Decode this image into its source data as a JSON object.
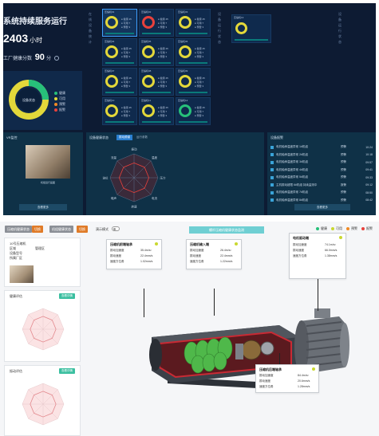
{
  "dashboard": {
    "title": "系统持续服务运行",
    "hours_value": "2403",
    "hours_unit": "小时",
    "health_label": "工厂健康分数",
    "health_score": "90",
    "health_unit": "分",
    "donut_center_label": "设备状态",
    "legend": [
      {
        "label": "健康",
        "color": "#27c07a"
      },
      {
        "label": "可用",
        "color": "#e3d83a"
      },
      {
        "label": "预警",
        "color": "#f08a24"
      },
      {
        "label": "报警",
        "color": "#e8413c"
      }
    ],
    "side_labels_left": [
      "在",
      "线",
      "设",
      "备",
      "统",
      "计"
    ],
    "side_labels_right": [
      "设",
      "备",
      "运",
      "行",
      "状",
      "态"
    ],
    "gauges": [
      {
        "name": "压缩机01",
        "ring": "#e3d83a",
        "selected": true
      },
      {
        "name": "压缩机02",
        "ring": "#e8413c",
        "selected": false
      },
      {
        "name": "压缩机03",
        "ring": "#e3d83a",
        "selected": false
      },
      {
        "name": "压缩机04",
        "ring": "#e3d83a",
        "selected": false
      },
      {
        "name": "压缩机05",
        "ring": "#e3d83a",
        "selected": false
      },
      {
        "name": "压缩机06",
        "ring": "#e3d83a",
        "selected": false
      },
      {
        "name": "压缩机07",
        "ring": "#e3d83a",
        "selected": false
      },
      {
        "name": "压缩机08",
        "ring": "#e3d83a",
        "selected": false
      },
      {
        "name": "压缩机09",
        "ring": "#e3d83a",
        "selected": false
      },
      {
        "name": "压缩机10",
        "ring": "#e3d83a",
        "selected": false
      },
      {
        "name": "压缩机11",
        "ring": "#e3d83a",
        "selected": false
      },
      {
        "name": "压缩机12",
        "ring": "#27c07a",
        "selected": false
      }
    ],
    "gauge_stats": [
      "● 健康 45",
      "● 可用 7",
      "● 预警 3"
    ],
    "extra_gauge_name": "压缩机13",
    "video_panel_title": "VR监控",
    "video_caption": "机组运行画面",
    "video_button": "查看更多",
    "radar_panel_title": "设备健康状态",
    "radar_tabs": [
      "振动频谱",
      "运行参数"
    ],
    "radar_labels": [
      "振动",
      "温度",
      "压力",
      "电流",
      "转速",
      "噪声",
      "油位",
      "流量"
    ],
    "alarm_panel_title": "设备报警",
    "alarms": [
      {
        "text": "电机轴承温度异常 1#机组",
        "level": "预警",
        "time": "10:24"
      },
      {
        "text": "电机轴承温度异常 2#机组",
        "level": "预警",
        "time": "10:18"
      },
      {
        "text": "电机轴承温度异常 3#机组",
        "level": "预警",
        "time": "09:57"
      },
      {
        "text": "电机轴承温度异常 4#机组",
        "level": "预警",
        "time": "09:41"
      },
      {
        "text": "电机轴承温度异常 5#机组",
        "level": "预警",
        "time": "09:33"
      },
      {
        "text": "主机振动超限 6#机组 持续监测中",
        "level": "报警",
        "time": "09:12"
      },
      {
        "text": "电机轴承温度异常 7#机组",
        "level": "预警",
        "time": "08:50"
      },
      {
        "text": "电机轴承温度异常 8#机组",
        "level": "预警",
        "time": "08:42"
      }
    ],
    "alarm_button": "查看更多"
  },
  "ui": {
    "tabs": [
      {
        "label": "压缩机健康状态",
        "style": "gray"
      },
      {
        "label": "切换",
        "style": "orange"
      },
      {
        "label": "机组健康状态",
        "style": "gray"
      },
      {
        "label": "切换",
        "style": "orange"
      }
    ],
    "toggle_label": "演示模式",
    "center_title": "螺杆压缩机健康状态监测",
    "status_legend": [
      {
        "label": "健康",
        "color": "#27c07a"
      },
      {
        "label": "可用",
        "color": "#c9d82f"
      },
      {
        "label": "预警",
        "color": "#f08a24"
      },
      {
        "label": "报警",
        "color": "#e8413c"
      }
    ],
    "device_card": {
      "name_label": "10号压缩机",
      "fields": [
        "区域",
        "设备型号",
        "所属厂区"
      ],
      "values": [
        "管理区",
        "",
        ""
      ]
    },
    "radar_card_1": {
      "title": "健康评估",
      "pill": "查看详情"
    },
    "radar_card_2": {
      "title": "振动评估",
      "pill": "查看详情"
    },
    "infoboxes": [
      {
        "title": "压缩机前端轴承",
        "rows": [
          [
            "振动加速度",
            "35.4m/s²"
          ],
          [
            "振动速度",
            "22.4mm/s"
          ],
          [
            "速度方位角",
            "1.02mm/s"
          ]
        ]
      },
      {
        "title": "压缩机输入端",
        "rows": [
          [
            "振动加速度",
            "26.4m/s²"
          ],
          [
            "振动速度",
            "22.4mm/s"
          ],
          [
            "速度方位角",
            "1.22mm/s"
          ]
        ]
      },
      {
        "title": "电机驱动端",
        "rows": [
          [
            "振动加速度",
            "74.1m/s²"
          ],
          [
            "振动速度",
            "66.0mm/s"
          ],
          [
            "速度方位角",
            "1.38mm/s"
          ]
        ]
      },
      {
        "title": "压缩机后端轴承",
        "rows": [
          [
            "振动加速度",
            "84.4m/s²"
          ],
          [
            "振动速度",
            "20.6mm/s"
          ],
          [
            "速度方位角",
            "1.28mm/s"
          ]
        ]
      }
    ]
  }
}
